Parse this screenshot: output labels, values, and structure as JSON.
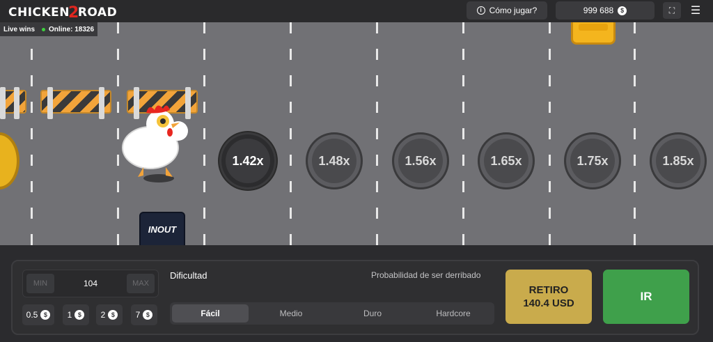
{
  "header": {
    "logo_left": "CHICKEN",
    "logo_num": "2",
    "logo_right": "ROAD",
    "how_to_play": "Cómo jugar?",
    "balance": "999 688",
    "currency_symbol": "$"
  },
  "live": {
    "live_wins": "Live wins",
    "online": "Online: 18326"
  },
  "road": {
    "multipliers": [
      "1.42x",
      "1.48x",
      "1.56x",
      "1.65x",
      "1.75x",
      "1.85x"
    ],
    "sign_text": "INOUT"
  },
  "bet": {
    "min_label": "MIN",
    "value": "104",
    "max_label": "MAX",
    "quick_amounts": [
      "0.5",
      "1",
      "2",
      "7"
    ]
  },
  "difficulty": {
    "label": "Dificultad",
    "probability_label": "Probabilidad de ser derribado",
    "levels": [
      "Fácil",
      "Medio",
      "Duro",
      "Hardcore"
    ],
    "selected": "Fácil"
  },
  "actions": {
    "cashout_label": "RETIRO",
    "cashout_amount": "140.4 USD",
    "go_label": "IR"
  },
  "colors": {
    "cashout": "#c9ab4c",
    "go": "#3fa04b",
    "road": "#717175",
    "online_dot": "#3ecf3e"
  }
}
